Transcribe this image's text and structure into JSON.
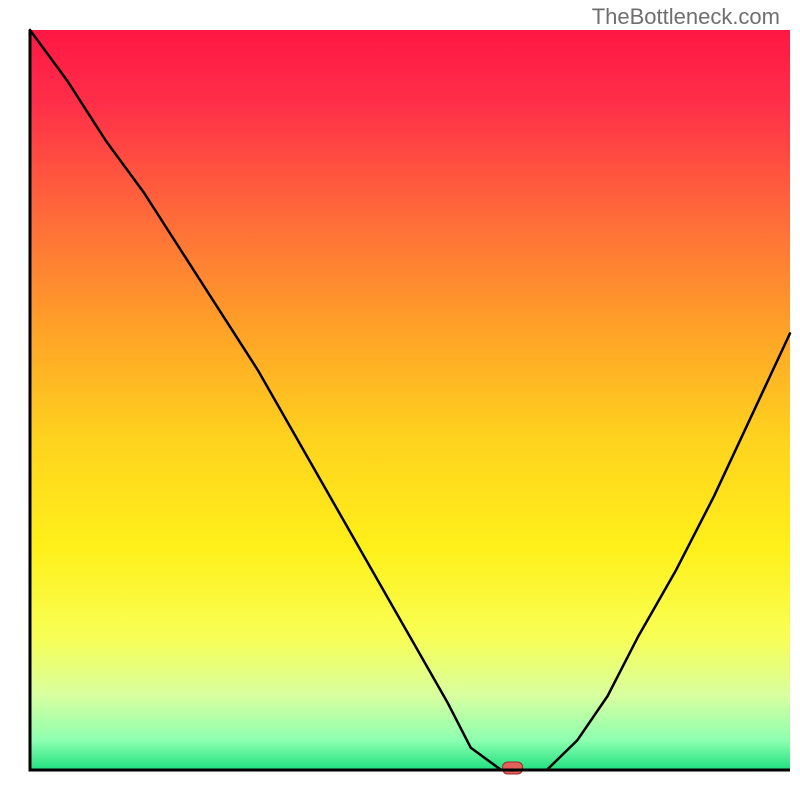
{
  "attribution": "TheBottleneck.com",
  "chart_data": {
    "type": "line",
    "title": "",
    "xlabel": "",
    "ylabel": "",
    "xlim": [
      0,
      100
    ],
    "ylim": [
      0,
      100
    ],
    "series": [
      {
        "name": "bottleneck-curve",
        "x": [
          0,
          5,
          10,
          15,
          20,
          25,
          30,
          35,
          40,
          45,
          50,
          55,
          58,
          62,
          65,
          68,
          72,
          76,
          80,
          85,
          90,
          95,
          100
        ],
        "y": [
          100,
          93,
          85,
          78,
          70,
          62,
          54,
          45,
          36,
          27,
          18,
          9,
          3,
          0,
          0,
          0,
          4,
          10,
          18,
          27,
          37,
          48,
          59
        ]
      }
    ],
    "marker": {
      "x": 63.5,
      "y": 0
    },
    "gradient_stops": [
      {
        "offset": 0.0,
        "color": "#ff1744"
      },
      {
        "offset": 0.1,
        "color": "#ff2f48"
      },
      {
        "offset": 0.25,
        "color": "#ff6a3a"
      },
      {
        "offset": 0.4,
        "color": "#ffa028"
      },
      {
        "offset": 0.55,
        "color": "#ffd21e"
      },
      {
        "offset": 0.7,
        "color": "#fff01a"
      },
      {
        "offset": 0.82,
        "color": "#f8ff55"
      },
      {
        "offset": 0.9,
        "color": "#d8ffa0"
      },
      {
        "offset": 0.96,
        "color": "#8cffb0"
      },
      {
        "offset": 1.0,
        "color": "#20e080"
      }
    ],
    "axis_color": "#000000",
    "axis_width": 3,
    "curve_color": "#000000",
    "curve_width": 2.5,
    "marker_fill": "#e0615a",
    "marker_stroke": "#a02830"
  }
}
